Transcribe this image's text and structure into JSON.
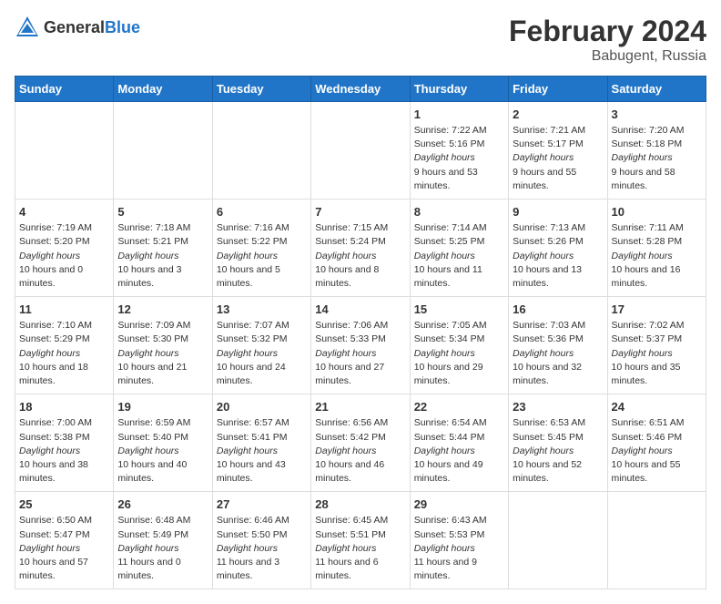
{
  "header": {
    "logo_general": "General",
    "logo_blue": "Blue",
    "title": "February 2024",
    "subtitle": "Babugent, Russia"
  },
  "days_of_week": [
    "Sunday",
    "Monday",
    "Tuesday",
    "Wednesday",
    "Thursday",
    "Friday",
    "Saturday"
  ],
  "weeks": [
    [
      {
        "day": "",
        "empty": true
      },
      {
        "day": "",
        "empty": true
      },
      {
        "day": "",
        "empty": true
      },
      {
        "day": "",
        "empty": true
      },
      {
        "day": "1",
        "sunrise": "7:22 AM",
        "sunset": "5:16 PM",
        "daylight": "9 hours and 53 minutes."
      },
      {
        "day": "2",
        "sunrise": "7:21 AM",
        "sunset": "5:17 PM",
        "daylight": "9 hours and 55 minutes."
      },
      {
        "day": "3",
        "sunrise": "7:20 AM",
        "sunset": "5:18 PM",
        "daylight": "9 hours and 58 minutes."
      }
    ],
    [
      {
        "day": "4",
        "sunrise": "7:19 AM",
        "sunset": "5:20 PM",
        "daylight": "10 hours and 0 minutes."
      },
      {
        "day": "5",
        "sunrise": "7:18 AM",
        "sunset": "5:21 PM",
        "daylight": "10 hours and 3 minutes."
      },
      {
        "day": "6",
        "sunrise": "7:16 AM",
        "sunset": "5:22 PM",
        "daylight": "10 hours and 5 minutes."
      },
      {
        "day": "7",
        "sunrise": "7:15 AM",
        "sunset": "5:24 PM",
        "daylight": "10 hours and 8 minutes."
      },
      {
        "day": "8",
        "sunrise": "7:14 AM",
        "sunset": "5:25 PM",
        "daylight": "10 hours and 11 minutes."
      },
      {
        "day": "9",
        "sunrise": "7:13 AM",
        "sunset": "5:26 PM",
        "daylight": "10 hours and 13 minutes."
      },
      {
        "day": "10",
        "sunrise": "7:11 AM",
        "sunset": "5:28 PM",
        "daylight": "10 hours and 16 minutes."
      }
    ],
    [
      {
        "day": "11",
        "sunrise": "7:10 AM",
        "sunset": "5:29 PM",
        "daylight": "10 hours and 18 minutes."
      },
      {
        "day": "12",
        "sunrise": "7:09 AM",
        "sunset": "5:30 PM",
        "daylight": "10 hours and 21 minutes."
      },
      {
        "day": "13",
        "sunrise": "7:07 AM",
        "sunset": "5:32 PM",
        "daylight": "10 hours and 24 minutes."
      },
      {
        "day": "14",
        "sunrise": "7:06 AM",
        "sunset": "5:33 PM",
        "daylight": "10 hours and 27 minutes."
      },
      {
        "day": "15",
        "sunrise": "7:05 AM",
        "sunset": "5:34 PM",
        "daylight": "10 hours and 29 minutes."
      },
      {
        "day": "16",
        "sunrise": "7:03 AM",
        "sunset": "5:36 PM",
        "daylight": "10 hours and 32 minutes."
      },
      {
        "day": "17",
        "sunrise": "7:02 AM",
        "sunset": "5:37 PM",
        "daylight": "10 hours and 35 minutes."
      }
    ],
    [
      {
        "day": "18",
        "sunrise": "7:00 AM",
        "sunset": "5:38 PM",
        "daylight": "10 hours and 38 minutes."
      },
      {
        "day": "19",
        "sunrise": "6:59 AM",
        "sunset": "5:40 PM",
        "daylight": "10 hours and 40 minutes."
      },
      {
        "day": "20",
        "sunrise": "6:57 AM",
        "sunset": "5:41 PM",
        "daylight": "10 hours and 43 minutes."
      },
      {
        "day": "21",
        "sunrise": "6:56 AM",
        "sunset": "5:42 PM",
        "daylight": "10 hours and 46 minutes."
      },
      {
        "day": "22",
        "sunrise": "6:54 AM",
        "sunset": "5:44 PM",
        "daylight": "10 hours and 49 minutes."
      },
      {
        "day": "23",
        "sunrise": "6:53 AM",
        "sunset": "5:45 PM",
        "daylight": "10 hours and 52 minutes."
      },
      {
        "day": "24",
        "sunrise": "6:51 AM",
        "sunset": "5:46 PM",
        "daylight": "10 hours and 55 minutes."
      }
    ],
    [
      {
        "day": "25",
        "sunrise": "6:50 AM",
        "sunset": "5:47 PM",
        "daylight": "10 hours and 57 minutes."
      },
      {
        "day": "26",
        "sunrise": "6:48 AM",
        "sunset": "5:49 PM",
        "daylight": "11 hours and 0 minutes."
      },
      {
        "day": "27",
        "sunrise": "6:46 AM",
        "sunset": "5:50 PM",
        "daylight": "11 hours and 3 minutes."
      },
      {
        "day": "28",
        "sunrise": "6:45 AM",
        "sunset": "5:51 PM",
        "daylight": "11 hours and 6 minutes."
      },
      {
        "day": "29",
        "sunrise": "6:43 AM",
        "sunset": "5:53 PM",
        "daylight": "11 hours and 9 minutes."
      },
      {
        "day": "",
        "empty": true
      },
      {
        "day": "",
        "empty": true
      }
    ]
  ]
}
